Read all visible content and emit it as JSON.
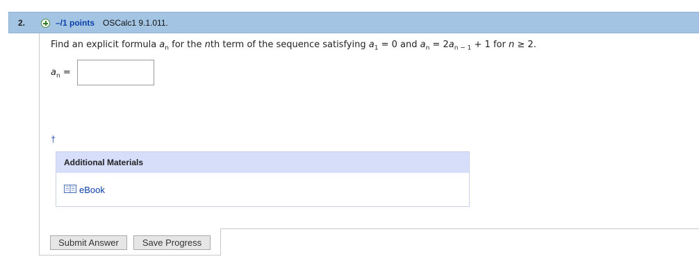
{
  "question": {
    "number": "2.",
    "points": "–/1 points",
    "source": "OSCalc1 9.1.011.",
    "prompt_part1": "Find an explicit formula ",
    "var_a": "a",
    "sub_n": "n",
    "prompt_part2": " for the ",
    "n_italic": "n",
    "prompt_part3": "th term of the sequence satisfying ",
    "sub_1": "1",
    "prompt_part4": " = 0 and ",
    "prompt_part5": " = 2",
    "sub_n_minus_1": "n − 1",
    "prompt_part6": " + 1 for ",
    "prompt_part7": " ≥ 2."
  },
  "answer": {
    "label_var": "a",
    "label_sub": "n",
    "label_eq": " =",
    "value": "",
    "placeholder": ""
  },
  "dagger": "†",
  "materials": {
    "title": "Additional Materials",
    "ebook_label": "eBook",
    "ebook_icon": "book-icon"
  },
  "buttons": {
    "submit_label": "Submit Answer",
    "save_label": "Save Progress"
  },
  "colors": {
    "header_bg": "#a3c5e3",
    "materials_header_bg": "#d6defa",
    "link": "#0b3fa8"
  }
}
